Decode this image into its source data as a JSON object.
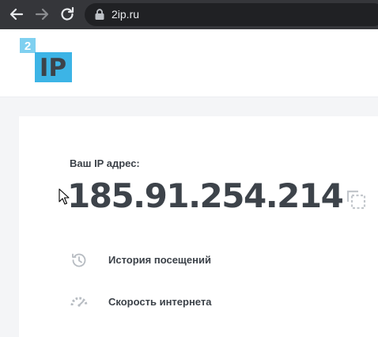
{
  "browser": {
    "url": "2ip.ru",
    "icons": {
      "back": "arrow-left-icon",
      "forward": "arrow-right-icon",
      "reload": "reload-icon",
      "secure": "lock-icon"
    }
  },
  "logo": {
    "number": "2",
    "letters": "IP",
    "colors": {
      "badge": "#7fd0f0",
      "tile": "#3cb4e6"
    }
  },
  "ip_block": {
    "label": "Ваш IP адрес:",
    "value": "185.91.254.214",
    "copy_icon": "copy-icon"
  },
  "menu": [
    {
      "label": "История посещений",
      "icon": "history-icon"
    },
    {
      "label": "Скорость интернета",
      "icon": "speedometer-icon"
    }
  ],
  "colors": {
    "text": "#3b4148",
    "icon": "#b7bcc2",
    "chrome": "#35363a"
  }
}
